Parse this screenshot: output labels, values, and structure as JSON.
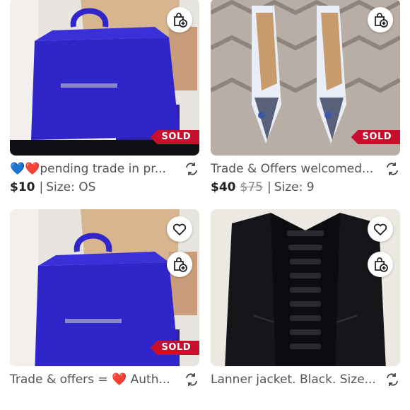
{
  "listings": [
    {
      "title_prefix": "💙❤️",
      "title": "pending trade in pr...",
      "price": "$10",
      "size_label": "Size: OS",
      "badge": "SOLD"
    },
    {
      "title": "Trade & Offers welcomed...",
      "price": "$40",
      "original_price": "$75",
      "size_label": "Size: 9",
      "badge": "SOLD"
    },
    {
      "title": "Trade & offers = ❤️ Auth...",
      "badge": "SOLD"
    },
    {
      "title": "Lanner jacket. Black. Size..."
    }
  ],
  "colors": {
    "sold_badge": "#c8102e",
    "bag_blue": "#2f25c8",
    "jacket": "#15151a"
  },
  "icons": {
    "bundle": "shopping-bag-plus-icon",
    "like": "heart-outline-icon",
    "trade": "swap-arrows-icon"
  }
}
